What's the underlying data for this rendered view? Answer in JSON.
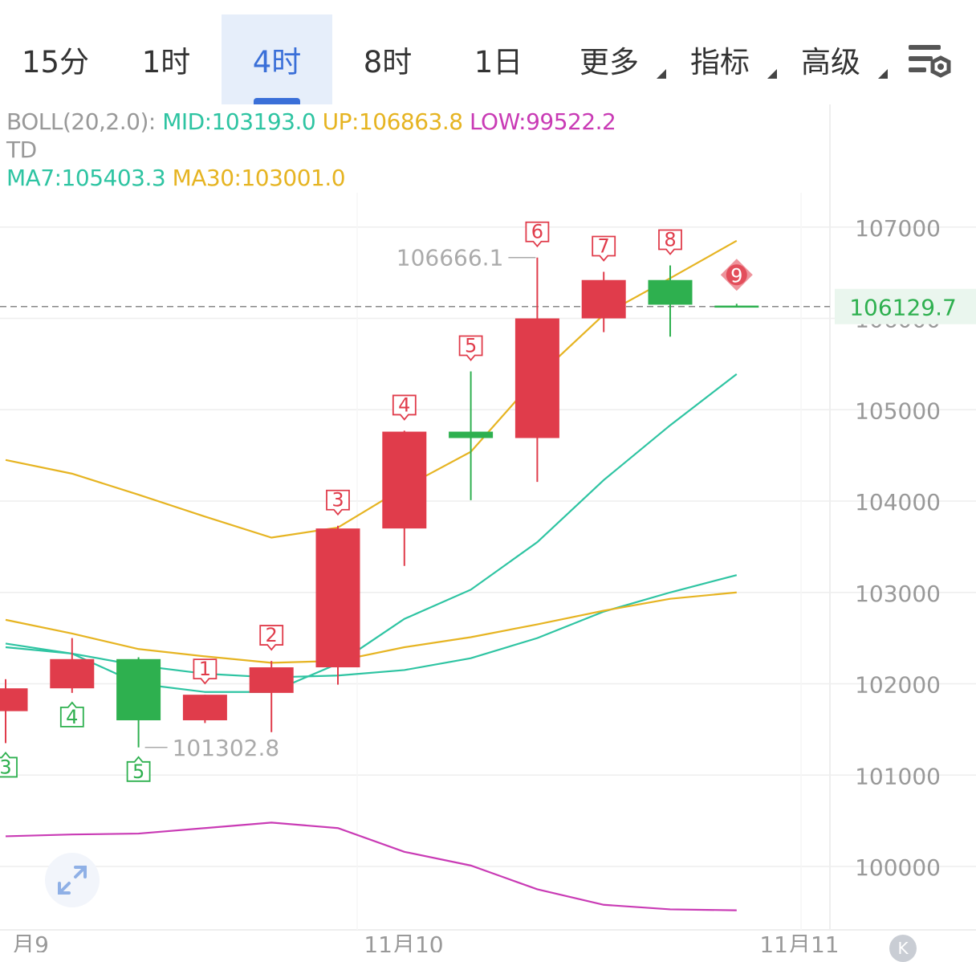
{
  "tabs": [
    {
      "label": "15分",
      "active": false,
      "caret": false
    },
    {
      "label": "1时",
      "active": false,
      "caret": false
    },
    {
      "label": "4时",
      "active": true,
      "caret": false
    },
    {
      "label": "8时",
      "active": false,
      "caret": false
    },
    {
      "label": "1日",
      "active": false,
      "caret": false
    },
    {
      "label": "更多",
      "active": false,
      "caret": true
    },
    {
      "label": "指标",
      "active": false,
      "caret": true
    },
    {
      "label": "高级",
      "active": false,
      "caret": true
    }
  ],
  "settings_icon": "chart-settings-icon",
  "legend": {
    "boll_prefix": "BOLL(20,2.0):",
    "boll_mid": "MID:103193.0",
    "boll_up": "UP:106863.8",
    "boll_low": "LOW:99522.2",
    "td": "TD",
    "ma7": "MA7:105403.3",
    "ma30": "MA30:103001.0"
  },
  "colors": {
    "up": "#e03c4b",
    "down": "#2eb04f",
    "mid": "#2ec4a2",
    "upper": "#e6b422",
    "lower": "#c93bb5",
    "ma7": "#2ec4a2",
    "ma30": "#e6b422",
    "accent": "#3a6fd8",
    "grid": "#eeeeee",
    "axis_text": "#999999",
    "price_tag": "#2eb04f"
  },
  "current_price": "106129.7",
  "high_label": "106666.1",
  "low_label": "101302.8",
  "expand_icon": "expand-icon",
  "k_badge": "K",
  "chart_data": {
    "type": "candlestick",
    "ylim": [
      99450,
      107650
    ],
    "y_ticks": [
      "100000",
      "101000",
      "102000",
      "103000",
      "104000",
      "105000",
      "106000",
      "107000"
    ],
    "x_labels": [
      "月9",
      "11月10",
      "11月11"
    ],
    "candles": [
      {
        "open": 101700,
        "high": 102050,
        "low": 101350,
        "close": 101950
      },
      {
        "open": 101950,
        "high": 102500,
        "low": 101900,
        "close": 102270
      },
      {
        "open": 102270,
        "high": 102290,
        "low": 101302.8,
        "close": 101600
      },
      {
        "open": 101600,
        "high": 101880,
        "low": 101570,
        "close": 101880
      },
      {
        "open": 101900,
        "high": 102250,
        "low": 101470,
        "close": 102180
      },
      {
        "open": 102180,
        "high": 103730,
        "low": 101990,
        "close": 103700
      },
      {
        "open": 103700,
        "high": 104770,
        "low": 103290,
        "close": 104760
      },
      {
        "open": 104760,
        "high": 105420,
        "low": 104010,
        "close": 104690
      },
      {
        "open": 104690,
        "high": 106666.1,
        "low": 104210,
        "close": 106000
      },
      {
        "open": 106000,
        "high": 106510,
        "low": 105850,
        "close": 106420
      },
      {
        "open": 106420,
        "high": 106580,
        "low": 105800,
        "close": 106150
      },
      {
        "open": 106140,
        "high": 106160,
        "low": 106125,
        "close": 106129.7
      }
    ],
    "td_marks": [
      {
        "index": 0,
        "label": "3",
        "position": "below",
        "color": "down"
      },
      {
        "index": 1,
        "label": "4",
        "position": "below",
        "color": "down"
      },
      {
        "index": 2,
        "label": "5",
        "position": "below",
        "color": "down"
      },
      {
        "index": 3,
        "label": "1",
        "position": "above",
        "color": "up"
      },
      {
        "index": 4,
        "label": "2",
        "position": "above",
        "color": "up"
      },
      {
        "index": 5,
        "label": "3",
        "position": "above",
        "color": "up"
      },
      {
        "index": 6,
        "label": "4",
        "position": "above",
        "color": "up"
      },
      {
        "index": 7,
        "label": "5",
        "position": "above",
        "color": "up"
      },
      {
        "index": 8,
        "label": "6",
        "position": "above",
        "color": "up"
      },
      {
        "index": 9,
        "label": "7",
        "position": "above",
        "color": "up"
      },
      {
        "index": 10,
        "label": "8",
        "position": "above",
        "color": "up"
      },
      {
        "index": 11,
        "label": "9",
        "position": "above",
        "color": "up",
        "style": "diamond"
      }
    ],
    "series": [
      {
        "name": "BOLL UP",
        "color": "upper",
        "values": [
          104450,
          104300,
          104070,
          103830,
          103600,
          103710,
          104150,
          104540,
          105360,
          106040,
          106440,
          106850
        ]
      },
      {
        "name": "BOLL MID",
        "color": "mid",
        "values": [
          102400,
          102330,
          102000,
          101910,
          101910,
          102220,
          102710,
          103030,
          103550,
          104230,
          104830,
          105390
        ]
      },
      {
        "name": "BOLL LOW",
        "color": "lower",
        "values": [
          100330,
          100350,
          100360,
          100420,
          100480,
          100420,
          100160,
          100010,
          99750,
          99580,
          99530,
          99520
        ]
      },
      {
        "name": "MA7",
        "color": "ma7",
        "values": [
          102440,
          102330,
          102200,
          102110,
          102070,
          102090,
          102150,
          102280,
          102500,
          102790,
          103000,
          103190
        ]
      },
      {
        "name": "MA30",
        "color": "ma30",
        "values": [
          102700,
          102550,
          102380,
          102300,
          102230,
          102250,
          102400,
          102510,
          102650,
          102800,
          102930,
          103000
        ]
      }
    ]
  }
}
